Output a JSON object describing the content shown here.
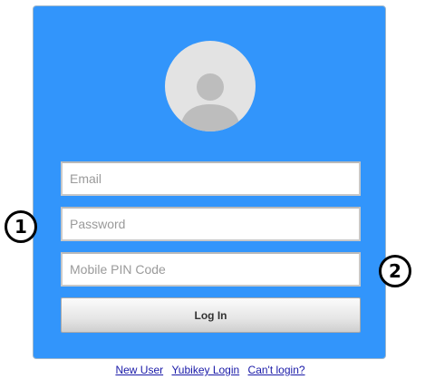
{
  "login": {
    "email_placeholder": "Email",
    "password_placeholder": "Password",
    "pin_placeholder": "Mobile PIN Code",
    "login_button": "Log In"
  },
  "links": {
    "new_user": "New User",
    "yubikey_login": "Yubikey Login",
    "cant_login": "Can't login?"
  },
  "annotations": {
    "marker_1": "1",
    "marker_2": "2"
  },
  "colors": {
    "card_background": "#3295fb",
    "avatar_background": "#e3e3e3",
    "avatar_silhouette": "#bdbdbd",
    "link": "#1a1aa8"
  },
  "icons": {
    "avatar": "user-silhouette-icon"
  }
}
